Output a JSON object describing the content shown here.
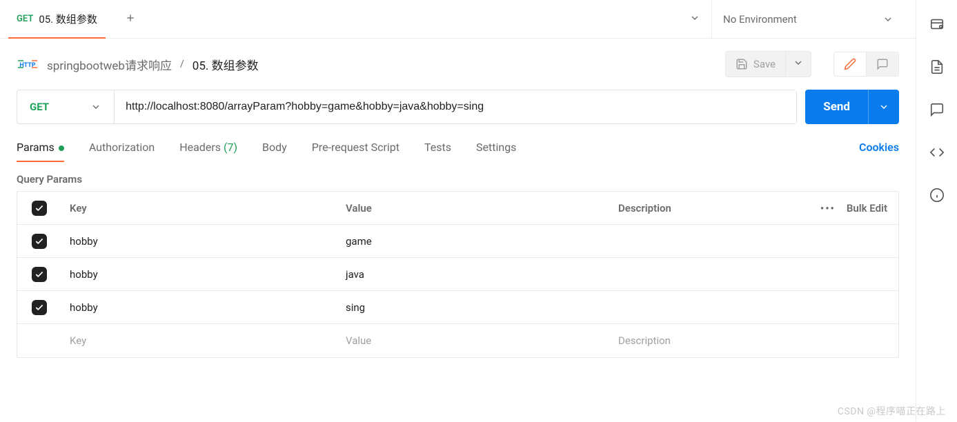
{
  "tabs": {
    "method": "GET",
    "title": "05. 数组参数"
  },
  "environment": {
    "label": "No Environment"
  },
  "breadcrumb": {
    "collection": "springbootweb请求响应",
    "current": "05. 数组参数",
    "save_label": "Save"
  },
  "request": {
    "method": "GET",
    "url": "http://localhost:8080/arrayParam?hobby=game&hobby=java&hobby=sing",
    "send_label": "Send"
  },
  "subtabs": {
    "params": "Params",
    "authorization": "Authorization",
    "headers_label": "Headers",
    "headers_count": "(7)",
    "body": "Body",
    "prerequest": "Pre-request Script",
    "tests": "Tests",
    "settings": "Settings",
    "cookies": "Cookies"
  },
  "params_section": {
    "title": "Query Params",
    "col_key": "Key",
    "col_value": "Value",
    "col_desc": "Description",
    "bulk_edit": "Bulk Edit",
    "rows": [
      {
        "key": "hobby",
        "value": "game",
        "desc": ""
      },
      {
        "key": "hobby",
        "value": "java",
        "desc": ""
      },
      {
        "key": "hobby",
        "value": "sing",
        "desc": ""
      }
    ],
    "placeholder_key": "Key",
    "placeholder_value": "Value",
    "placeholder_desc": "Description"
  },
  "watermark": "CSDN @程序喵正在路上"
}
